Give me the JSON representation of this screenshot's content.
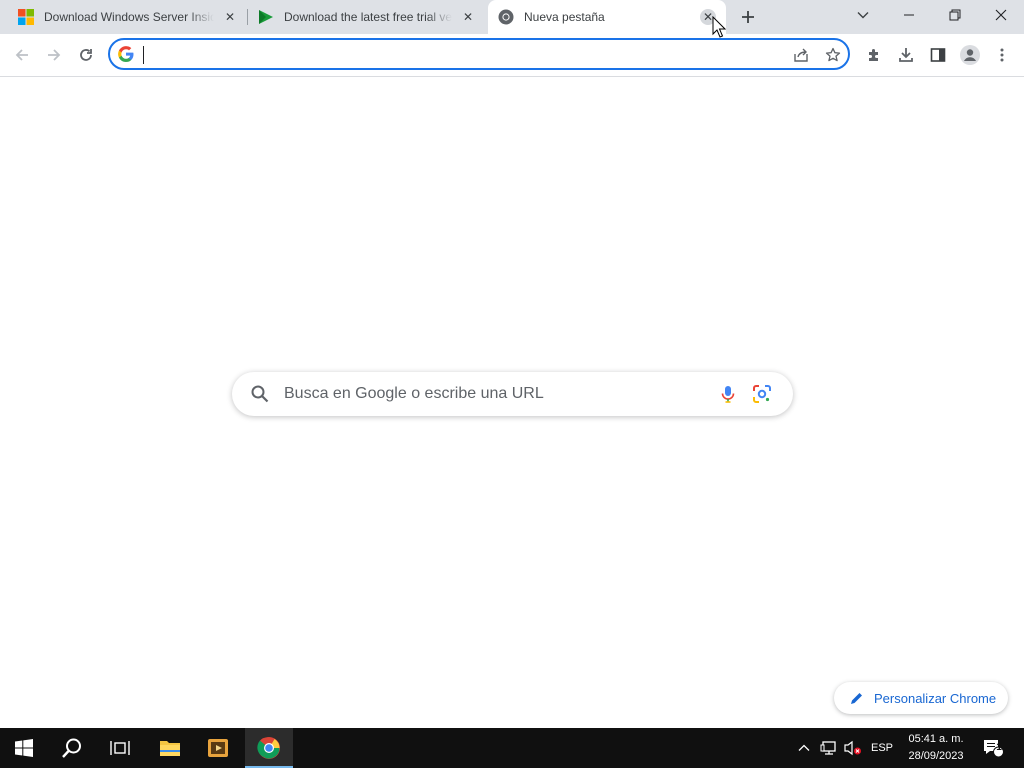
{
  "browser": {
    "tabs": [
      {
        "title": "Download Windows Server Insider Preview",
        "favicon": "windows-logo-icon",
        "active": false
      },
      {
        "title": "Download the latest free trial version",
        "favicon": "green-play-icon",
        "active": false
      },
      {
        "title": "Nueva pestaña",
        "favicon": "chrome-logo-icon",
        "active": true
      }
    ],
    "omnibox": {
      "value": "",
      "placeholder": ""
    },
    "accent": "#1a73e8"
  },
  "ntp": {
    "search_placeholder": "Busca en Google o escribe una URL",
    "customize_label": "Personalizar Chrome"
  },
  "taskbar": {
    "apps": [
      "start-icon",
      "search-icon",
      "task-view-icon",
      "file-explorer-icon",
      "media-app-icon",
      "chrome-icon"
    ],
    "language": "ESP",
    "time": "05:41 a. m.",
    "date": "28/09/2023",
    "notification_count": "1"
  }
}
